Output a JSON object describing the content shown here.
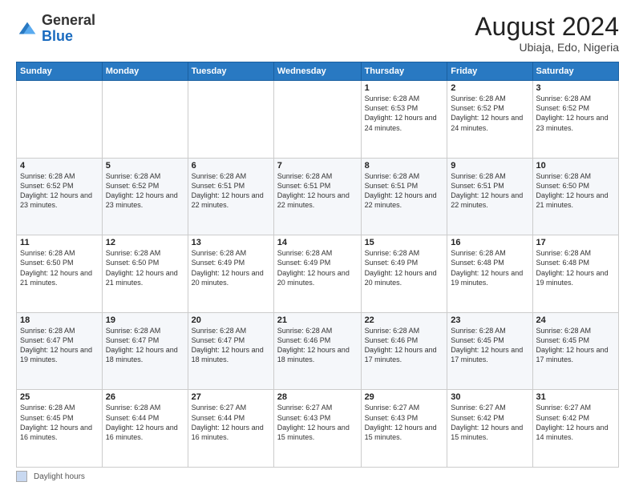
{
  "header": {
    "logo_general": "General",
    "logo_blue": "Blue",
    "month_year": "August 2024",
    "location": "Ubiaja, Edo, Nigeria"
  },
  "days_of_week": [
    "Sunday",
    "Monday",
    "Tuesday",
    "Wednesday",
    "Thursday",
    "Friday",
    "Saturday"
  ],
  "weeks": [
    [
      {
        "day": "",
        "sunrise": "",
        "sunset": "",
        "daylight": ""
      },
      {
        "day": "",
        "sunrise": "",
        "sunset": "",
        "daylight": ""
      },
      {
        "day": "",
        "sunrise": "",
        "sunset": "",
        "daylight": ""
      },
      {
        "day": "",
        "sunrise": "",
        "sunset": "",
        "daylight": ""
      },
      {
        "day": "1",
        "sunrise": "Sunrise: 6:28 AM",
        "sunset": "Sunset: 6:53 PM",
        "daylight": "Daylight: 12 hours and 24 minutes."
      },
      {
        "day": "2",
        "sunrise": "Sunrise: 6:28 AM",
        "sunset": "Sunset: 6:52 PM",
        "daylight": "Daylight: 12 hours and 24 minutes."
      },
      {
        "day": "3",
        "sunrise": "Sunrise: 6:28 AM",
        "sunset": "Sunset: 6:52 PM",
        "daylight": "Daylight: 12 hours and 23 minutes."
      }
    ],
    [
      {
        "day": "4",
        "sunrise": "Sunrise: 6:28 AM",
        "sunset": "Sunset: 6:52 PM",
        "daylight": "Daylight: 12 hours and 23 minutes."
      },
      {
        "day": "5",
        "sunrise": "Sunrise: 6:28 AM",
        "sunset": "Sunset: 6:52 PM",
        "daylight": "Daylight: 12 hours and 23 minutes."
      },
      {
        "day": "6",
        "sunrise": "Sunrise: 6:28 AM",
        "sunset": "Sunset: 6:51 PM",
        "daylight": "Daylight: 12 hours and 22 minutes."
      },
      {
        "day": "7",
        "sunrise": "Sunrise: 6:28 AM",
        "sunset": "Sunset: 6:51 PM",
        "daylight": "Daylight: 12 hours and 22 minutes."
      },
      {
        "day": "8",
        "sunrise": "Sunrise: 6:28 AM",
        "sunset": "Sunset: 6:51 PM",
        "daylight": "Daylight: 12 hours and 22 minutes."
      },
      {
        "day": "9",
        "sunrise": "Sunrise: 6:28 AM",
        "sunset": "Sunset: 6:51 PM",
        "daylight": "Daylight: 12 hours and 22 minutes."
      },
      {
        "day": "10",
        "sunrise": "Sunrise: 6:28 AM",
        "sunset": "Sunset: 6:50 PM",
        "daylight": "Daylight: 12 hours and 21 minutes."
      }
    ],
    [
      {
        "day": "11",
        "sunrise": "Sunrise: 6:28 AM",
        "sunset": "Sunset: 6:50 PM",
        "daylight": "Daylight: 12 hours and 21 minutes."
      },
      {
        "day": "12",
        "sunrise": "Sunrise: 6:28 AM",
        "sunset": "Sunset: 6:50 PM",
        "daylight": "Daylight: 12 hours and 21 minutes."
      },
      {
        "day": "13",
        "sunrise": "Sunrise: 6:28 AM",
        "sunset": "Sunset: 6:49 PM",
        "daylight": "Daylight: 12 hours and 20 minutes."
      },
      {
        "day": "14",
        "sunrise": "Sunrise: 6:28 AM",
        "sunset": "Sunset: 6:49 PM",
        "daylight": "Daylight: 12 hours and 20 minutes."
      },
      {
        "day": "15",
        "sunrise": "Sunrise: 6:28 AM",
        "sunset": "Sunset: 6:49 PM",
        "daylight": "Daylight: 12 hours and 20 minutes."
      },
      {
        "day": "16",
        "sunrise": "Sunrise: 6:28 AM",
        "sunset": "Sunset: 6:48 PM",
        "daylight": "Daylight: 12 hours and 19 minutes."
      },
      {
        "day": "17",
        "sunrise": "Sunrise: 6:28 AM",
        "sunset": "Sunset: 6:48 PM",
        "daylight": "Daylight: 12 hours and 19 minutes."
      }
    ],
    [
      {
        "day": "18",
        "sunrise": "Sunrise: 6:28 AM",
        "sunset": "Sunset: 6:47 PM",
        "daylight": "Daylight: 12 hours and 19 minutes."
      },
      {
        "day": "19",
        "sunrise": "Sunrise: 6:28 AM",
        "sunset": "Sunset: 6:47 PM",
        "daylight": "Daylight: 12 hours and 18 minutes."
      },
      {
        "day": "20",
        "sunrise": "Sunrise: 6:28 AM",
        "sunset": "Sunset: 6:47 PM",
        "daylight": "Daylight: 12 hours and 18 minutes."
      },
      {
        "day": "21",
        "sunrise": "Sunrise: 6:28 AM",
        "sunset": "Sunset: 6:46 PM",
        "daylight": "Daylight: 12 hours and 18 minutes."
      },
      {
        "day": "22",
        "sunrise": "Sunrise: 6:28 AM",
        "sunset": "Sunset: 6:46 PM",
        "daylight": "Daylight: 12 hours and 17 minutes."
      },
      {
        "day": "23",
        "sunrise": "Sunrise: 6:28 AM",
        "sunset": "Sunset: 6:45 PM",
        "daylight": "Daylight: 12 hours and 17 minutes."
      },
      {
        "day": "24",
        "sunrise": "Sunrise: 6:28 AM",
        "sunset": "Sunset: 6:45 PM",
        "daylight": "Daylight: 12 hours and 17 minutes."
      }
    ],
    [
      {
        "day": "25",
        "sunrise": "Sunrise: 6:28 AM",
        "sunset": "Sunset: 6:45 PM",
        "daylight": "Daylight: 12 hours and 16 minutes."
      },
      {
        "day": "26",
        "sunrise": "Sunrise: 6:28 AM",
        "sunset": "Sunset: 6:44 PM",
        "daylight": "Daylight: 12 hours and 16 minutes."
      },
      {
        "day": "27",
        "sunrise": "Sunrise: 6:27 AM",
        "sunset": "Sunset: 6:44 PM",
        "daylight": "Daylight: 12 hours and 16 minutes."
      },
      {
        "day": "28",
        "sunrise": "Sunrise: 6:27 AM",
        "sunset": "Sunset: 6:43 PM",
        "daylight": "Daylight: 12 hours and 15 minutes."
      },
      {
        "day": "29",
        "sunrise": "Sunrise: 6:27 AM",
        "sunset": "Sunset: 6:43 PM",
        "daylight": "Daylight: 12 hours and 15 minutes."
      },
      {
        "day": "30",
        "sunrise": "Sunrise: 6:27 AM",
        "sunset": "Sunset: 6:42 PM",
        "daylight": "Daylight: 12 hours and 15 minutes."
      },
      {
        "day": "31",
        "sunrise": "Sunrise: 6:27 AM",
        "sunset": "Sunset: 6:42 PM",
        "daylight": "Daylight: 12 hours and 14 minutes."
      }
    ]
  ],
  "footer": {
    "daylight_label": "Daylight hours"
  }
}
